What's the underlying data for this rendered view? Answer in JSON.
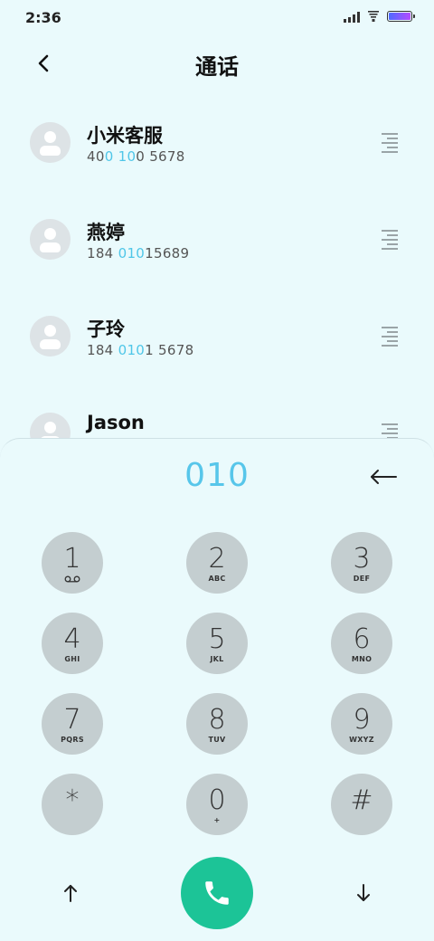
{
  "status_bar": {
    "time": "2:36",
    "icons": [
      "signal-icon",
      "wifi-icon",
      "battery-icon"
    ],
    "battery_level": 1.0
  },
  "header": {
    "title": "通话",
    "back_icon": "chevron-left-icon"
  },
  "contacts": [
    {
      "name": "小米客服",
      "number_parts": [
        {
          "text": "40",
          "highlight": false
        },
        {
          "text": "0",
          "highlight": true
        },
        {
          "text": " ",
          "highlight": false
        },
        {
          "text": "10",
          "highlight": true
        },
        {
          "text": "0 5678",
          "highlight": false
        }
      ]
    },
    {
      "name": "燕婷",
      "number_parts": [
        {
          "text": "184 ",
          "highlight": false
        },
        {
          "text": "010",
          "highlight": true
        },
        {
          "text": "15689",
          "highlight": false
        }
      ]
    },
    {
      "name": "子玲",
      "number_parts": [
        {
          "text": "184 ",
          "highlight": false
        },
        {
          "text": "010",
          "highlight": true
        },
        {
          "text": "1 5678",
          "highlight": false
        }
      ]
    },
    {
      "name": "Jason",
      "number_parts": []
    }
  ],
  "dialer": {
    "number": "010",
    "backspace_icon": "backspace-arrow-icon",
    "keys": [
      {
        "digit": "1",
        "letters": "",
        "icon": "voicemail-icon"
      },
      {
        "digit": "2",
        "letters": "ABC"
      },
      {
        "digit": "3",
        "letters": "DEF"
      },
      {
        "digit": "4",
        "letters": "GHI"
      },
      {
        "digit": "5",
        "letters": "JKL"
      },
      {
        "digit": "6",
        "letters": "MNO"
      },
      {
        "digit": "7",
        "letters": "PQRS"
      },
      {
        "digit": "8",
        "letters": "TUV"
      },
      {
        "digit": "9",
        "letters": "WXYZ"
      },
      {
        "digit": "*",
        "letters": ""
      },
      {
        "digit": "0",
        "letters": "+"
      },
      {
        "digit": "#",
        "letters": ""
      }
    ]
  },
  "bottom_bar": {
    "left_icon": "arrow-up-icon",
    "call_icon": "phone-icon",
    "right_icon": "arrow-down-icon"
  },
  "colors": {
    "background": "#eafafc",
    "accent": "#57c6ea",
    "key_bg": "#c4ced0",
    "call_button": "#1cc497"
  }
}
